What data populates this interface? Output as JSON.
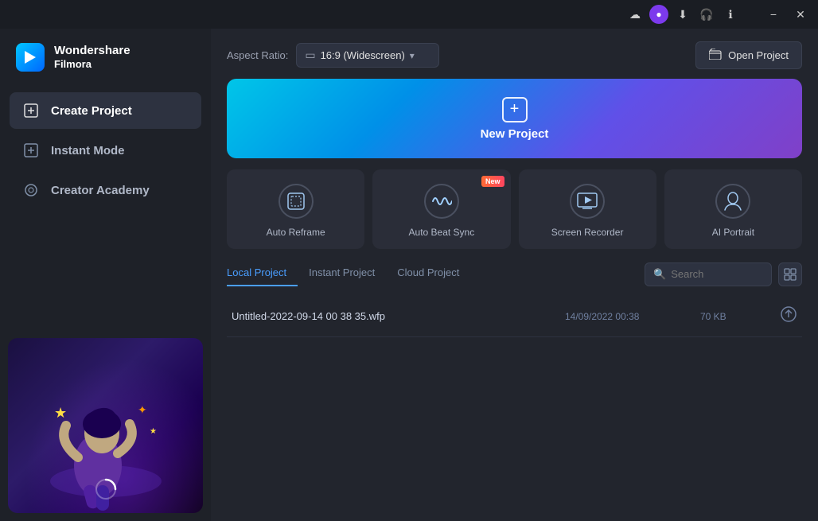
{
  "titlebar": {
    "cloud_icon": "☁",
    "avatar_icon": "👤",
    "download_icon": "⬇",
    "headphone_icon": "🎧",
    "info_icon": "ℹ",
    "minimize_label": "−",
    "close_label": "✕"
  },
  "logo": {
    "icon": "▶",
    "title": "Wondershare",
    "subtitle": "Filmora"
  },
  "sidebar": {
    "items": [
      {
        "id": "create-project",
        "label": "Create Project",
        "icon": "⊞",
        "active": true
      },
      {
        "id": "instant-mode",
        "label": "Instant Mode",
        "icon": "⊞",
        "active": false
      },
      {
        "id": "creator-academy",
        "label": "Creator Academy",
        "icon": "◎",
        "active": false
      }
    ]
  },
  "top_bar": {
    "aspect_ratio_label": "Aspect Ratio:",
    "aspect_ratio_icon": "▭",
    "aspect_ratio_value": "16:9 (Widescreen)",
    "open_project_label": "Open Project",
    "open_project_icon": "📁"
  },
  "new_project": {
    "label": "New Project"
  },
  "feature_cards": [
    {
      "id": "auto-reframe",
      "label": "Auto Reframe",
      "icon": "⊡",
      "new": false
    },
    {
      "id": "auto-beat-sync",
      "label": "Auto Beat Sync",
      "icon": "〜",
      "new": true
    },
    {
      "id": "screen-recorder",
      "label": "Screen Recorder",
      "icon": "▶",
      "new": false
    },
    {
      "id": "ai-portrait",
      "label": "AI Portrait",
      "icon": "👤",
      "new": false
    }
  ],
  "new_badge_text": "New",
  "projects": {
    "tabs": [
      {
        "id": "local",
        "label": "Local Project",
        "active": true
      },
      {
        "id": "instant",
        "label": "Instant Project",
        "active": false
      },
      {
        "id": "cloud",
        "label": "Cloud Project",
        "active": false
      }
    ],
    "search_placeholder": "Search",
    "rows": [
      {
        "name": "Untitled-2022-09-14 00 38 35.wfp",
        "date": "14/09/2022 00:38",
        "size": "70 KB"
      }
    ]
  }
}
